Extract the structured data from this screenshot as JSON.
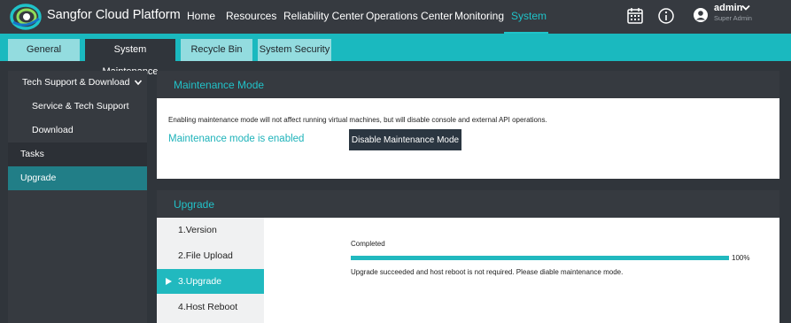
{
  "app": {
    "brand": "Sangfor Cloud Platform",
    "accent_color": "#1fc3c9",
    "logo_icon": "sangfor-logo"
  },
  "nav": {
    "items": [
      {
        "label": "Home"
      },
      {
        "label": "Resources"
      },
      {
        "label": "Reliability Center"
      },
      {
        "label": "Operations Center"
      },
      {
        "label": "Monitoring"
      },
      {
        "label": "System",
        "active": true
      }
    ]
  },
  "header_icons": [
    "calendar-icon",
    "info-icon",
    "user-icon",
    "chevron-down-icon"
  ],
  "user": {
    "name": "admin",
    "role": "Super Admin"
  },
  "tabs": [
    {
      "label": "General"
    },
    {
      "label": "System Maintenance",
      "active": true
    },
    {
      "label": "Recycle Bin"
    },
    {
      "label": "System Security"
    }
  ],
  "sidebar": {
    "items": [
      {
        "label": "Tech Support & Download",
        "expanded": true
      },
      {
        "label": "Service & Tech Support"
      },
      {
        "label": "Download"
      },
      {
        "label": "Tasks"
      },
      {
        "label": "Upgrade",
        "active": true
      }
    ]
  },
  "maintenance": {
    "title": "Maintenance Mode",
    "note": "Enabling maintenance mode will not affect running virtual machines, but will disable console and external API operations.",
    "status": "Maintenance mode is enabled",
    "button": "Disable Maintenance Mode"
  },
  "upgrade": {
    "title": "Upgrade",
    "steps": [
      {
        "label": "1.Version"
      },
      {
        "label": "2.File Upload"
      },
      {
        "label": "3.Upgrade",
        "active": true
      },
      {
        "label": "4.Host Reboot"
      }
    ],
    "progress_label": "Completed",
    "progress_value": 100,
    "progress_text": "100%",
    "result": "Upgrade succeeded and host reboot is not required. Please diable maintenance mode."
  }
}
